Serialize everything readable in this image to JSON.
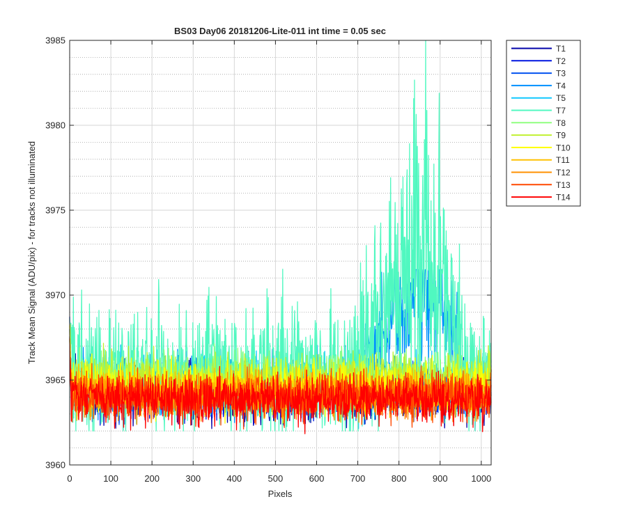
{
  "chart_data": {
    "type": "line",
    "title": "BS03 Day06 20181206-Lite-011 int time = 0.05 sec",
    "xlabel": "Pixels",
    "ylabel": "Track Mean Signal (ADU/pix) - for tracks not illuminated",
    "xlim": [
      0,
      1024
    ],
    "ylim": [
      3960,
      3985
    ],
    "xticks": [
      0,
      100,
      200,
      300,
      400,
      500,
      600,
      700,
      800,
      900,
      1000
    ],
    "yticks": [
      3960,
      3965,
      3970,
      3975,
      3980,
      3985
    ],
    "grid": true,
    "minor_grid": true,
    "legend_position": "outside-top-right",
    "approx_points_per_series": 1024,
    "series": [
      {
        "name": "T1",
        "color": "#0000a8",
        "mean": 3964.2,
        "noise_range": [
          3960.0,
          3970.0
        ]
      },
      {
        "name": "T2",
        "color": "#0015e0",
        "mean": 3964.4,
        "noise_range": [
          3960.5,
          3969.8
        ]
      },
      {
        "name": "T3",
        "color": "#0050f0",
        "mean": 3964.5,
        "noise_range": [
          3961.0,
          3969.5
        ]
      },
      {
        "name": "T4",
        "color": "#0090ff",
        "mean": 3964.7,
        "noise_range": [
          3961.0,
          3971.5
        ],
        "feature": {
          "x_range": [
            700,
            960
          ],
          "peak_x": 880,
          "peak_offset": 5.5
        }
      },
      {
        "name": "T5",
        "color": "#10c8ff",
        "mean": 3964.8,
        "noise_range": [
          3961.2,
          3970.5
        ]
      },
      {
        "name": "T7",
        "color": "#50f8c0",
        "mean": 3965.5,
        "noise_range": [
          3962.0,
          3985.0
        ],
        "feature": {
          "x_range": [
            700,
            960
          ],
          "peak_x": 865,
          "peak_offset": 7.0,
          "max_value": 3985.0
        }
      },
      {
        "name": "T8",
        "color": "#90ff80",
        "mean": 3965.3,
        "noise_range": [
          3961.5,
          3969.0
        ]
      },
      {
        "name": "T9",
        "color": "#c0f030",
        "mean": 3965.1,
        "noise_range": [
          3961.5,
          3969.5
        ]
      },
      {
        "name": "T10",
        "color": "#ffff00",
        "mean": 3964.6,
        "noise_range": [
          3960.5,
          3969.0
        ]
      },
      {
        "name": "T11",
        "color": "#ffc000",
        "mean": 3964.3,
        "noise_range": [
          3961.0,
          3968.5
        ]
      },
      {
        "name": "T12",
        "color": "#ff9000",
        "mean": 3964.1,
        "noise_range": [
          3960.5,
          3968.0
        ]
      },
      {
        "name": "T13",
        "color": "#ff4800",
        "mean": 3964.0,
        "noise_range": [
          3960.2,
          3968.5
        ]
      },
      {
        "name": "T14",
        "color": "#ff0000",
        "mean": 3963.9,
        "noise_range": [
          3960.0,
          3967.8
        ]
      }
    ]
  }
}
